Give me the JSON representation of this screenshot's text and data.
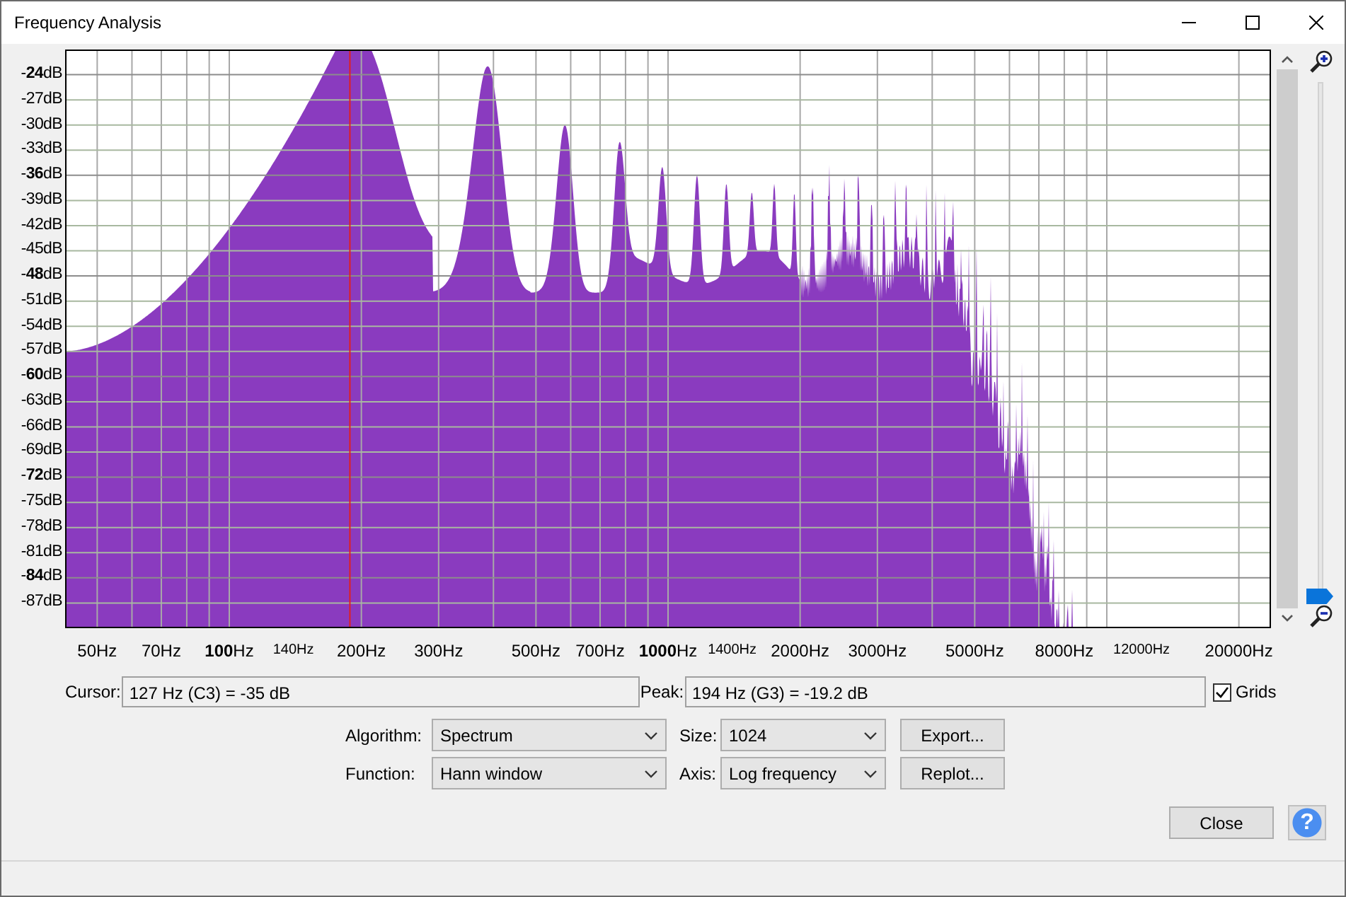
{
  "window": {
    "title": "Frequency Analysis"
  },
  "plot": {
    "y_labels": [
      "-**24**dB",
      "-27dB",
      "-30dB",
      "-33dB",
      "-**36**dB",
      "-39dB",
      "-42dB",
      "-45dB",
      "-**48**dB",
      "-51dB",
      "-54dB",
      "-57dB",
      "-**60**dB",
      "-63dB",
      "-66dB",
      "-69dB",
      "-**72**dB",
      "-75dB",
      "-78dB",
      "-81dB",
      "-**84**dB",
      "-87dB"
    ],
    "x_labels": [
      {
        "text": "50Hz",
        "small": false
      },
      {
        "text": "70Hz",
        "small": false
      },
      {
        "text": "**100**Hz",
        "small": false
      },
      {
        "text": "140Hz",
        "small": true
      },
      {
        "text": "200Hz",
        "small": false
      },
      {
        "text": "300Hz",
        "small": false
      },
      {
        "text": "500Hz",
        "small": false
      },
      {
        "text": "700Hz",
        "small": false
      },
      {
        "text": "**1000**Hz",
        "small": false
      },
      {
        "text": "1400Hz",
        "small": true
      },
      {
        "text": "2000Hz",
        "small": false
      },
      {
        "text": "3000Hz",
        "small": false
      },
      {
        "text": "5000Hz",
        "small": false
      },
      {
        "text": "8000Hz",
        "small": false
      },
      {
        "text": "12000Hz",
        "small": true
      },
      {
        "text": "20000Hz",
        "small": false
      }
    ],
    "zoom_slider": {
      "level": 0
    }
  },
  "readouts": [
    {
      "label": "Cursor:",
      "value": "127 Hz (C3) = -35 dB"
    },
    {
      "label": "Peak:",
      "value": "194 Hz (G3) = -19.2 dB"
    }
  ],
  "grids": {
    "label": "Grids",
    "checked": true
  },
  "settings": [
    {
      "label": "Algorithm:",
      "value": "Spectrum",
      "label2": "Size:",
      "value2": "1024",
      "button": "Export..."
    },
    {
      "label": "Function:",
      "value": "Hann window",
      "label2": "Axis:",
      "value2": "Log frequency",
      "button": "Replot..."
    }
  ],
  "close_button": "Close",
  "help_button": "?"
}
